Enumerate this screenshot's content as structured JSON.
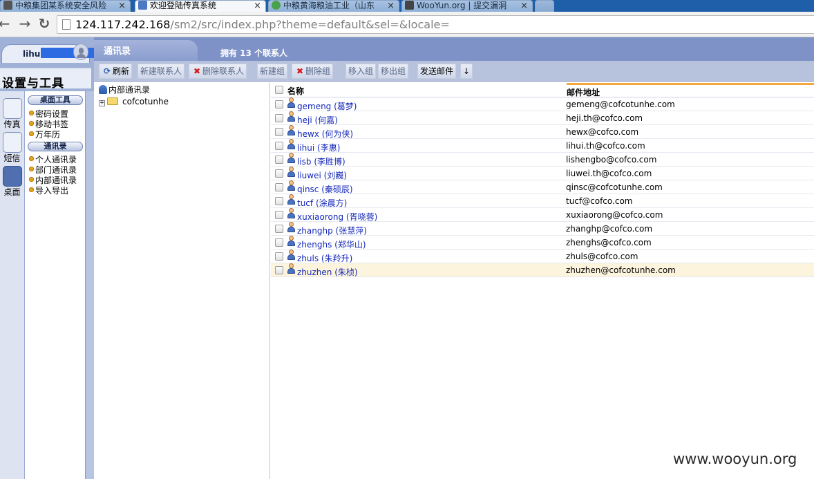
{
  "browser": {
    "tabs": [
      {
        "title": "中粮集团某系统安全风险",
        "active": false,
        "favicon_color": "#555555"
      },
      {
        "title": "欢迎登陆传真系统",
        "active": true,
        "favicon_color": "#4b79c4"
      },
      {
        "title": "中粮黄海粮油工业（山东",
        "active": false,
        "favicon_color": "#4aa24a"
      },
      {
        "title": "WooYun.org | 提交漏洞",
        "active": false,
        "favicon_color": "#444444"
      }
    ],
    "close_glyph": "×",
    "back_glyph": "←",
    "forward_glyph": "→",
    "reload_glyph": "↻",
    "url_host": "124.117.242.168",
    "url_path": "/sm2/src/index.php?theme=default&sel=&locale="
  },
  "sidebar": {
    "username": "lihui",
    "panel_title": "设置与工具",
    "big_buttons": [
      {
        "label": "传真",
        "icon": "fax-icon",
        "active": false
      },
      {
        "label": "短信",
        "icon": "phone-icon",
        "active": false
      },
      {
        "label": "桌面",
        "icon": "desktop-gear-icon",
        "active": true
      }
    ],
    "sections": [
      {
        "title": "桌面工具",
        "items": [
          "密码设置",
          "移动书签",
          "万年历"
        ]
      },
      {
        "title": "通讯录",
        "items": [
          "个人通讯录",
          "部门通讯录",
          "内部通讯录",
          "导入导出"
        ]
      }
    ]
  },
  "main": {
    "title": "通讯录",
    "contact_count_text": "拥有 13 个联系人",
    "actions": {
      "refresh": "刷新",
      "new_contact": "新建联系人",
      "delete_contact": "删除联系人",
      "new_group": "新建组",
      "delete_group": "删除组",
      "move_in_group": "移入组",
      "move_out_group": "移出组",
      "send_mail": "发送邮件",
      "more": "↓"
    },
    "tree": {
      "root": "内部通讯录",
      "expander": "+",
      "node": "cofcotunhe"
    },
    "table": {
      "columns": {
        "name": "名称",
        "email": "邮件地址"
      },
      "rows": [
        {
          "name": "gemeng (葛梦)",
          "email": "gemeng@cofcotunhe.com"
        },
        {
          "name": "heji (何嘉)",
          "email": "heji.th@cofco.com"
        },
        {
          "name": "hewx (何为侠)",
          "email": "hewx@cofco.com"
        },
        {
          "name": "lihui (李惠)",
          "email": "lihui.th@cofco.com"
        },
        {
          "name": "lisb (李胜博)",
          "email": "lishengbo@cofco.com"
        },
        {
          "name": "liuwei (刘巍)",
          "email": "liuwei.th@cofco.com"
        },
        {
          "name": "qinsc (秦硕辰)",
          "email": "qinsc@cofcotunhe.com"
        },
        {
          "name": "tucf (涂晨方)",
          "email": "tucf@cofco.com"
        },
        {
          "name": "xuxiaorong (胥晓蓉)",
          "email": "xuxiaorong@cofco.com"
        },
        {
          "name": "zhanghp (张慧萍)",
          "email": "zhanghp@cofco.com"
        },
        {
          "name": "zhenghs (郑华山)",
          "email": "zhenghs@cofco.com"
        },
        {
          "name": "zhuls (朱羚升)",
          "email": "zhuls@cofco.com"
        },
        {
          "name": "zhuzhen (朱桢)",
          "email": "zhuzhen@cofcotunhe.com",
          "highlighted": true
        }
      ]
    }
  },
  "watermark": "www.wooyun.org"
}
